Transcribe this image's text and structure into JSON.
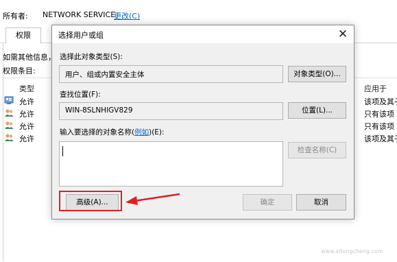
{
  "background": {
    "owner_label": "所有者:",
    "owner_value": "NETWORK SERVICE",
    "owner_change_link": "更改(C)",
    "tab_permissions": "权限",
    "info_text": "如需其他信息，",
    "entries_label": "权限条目:",
    "col_type": "类型",
    "col_applies_to": "应用于",
    "rows": [
      {
        "type": "允许",
        "applies_to": "该项及其子",
        "icon": "group-icon"
      },
      {
        "type": "允许",
        "applies_to": "只有该项",
        "icon": "users-icon"
      },
      {
        "type": "允许",
        "applies_to": "只有该项",
        "icon": "users-icon"
      },
      {
        "type": "允许",
        "applies_to": "该项及其子",
        "icon": "users-icon"
      }
    ]
  },
  "dialog": {
    "title": "选择用户或组",
    "object_type_label": "选择此对象类型(S):",
    "object_type_value": "用户、组或内置安全主体",
    "object_type_button": "对象类型(O)...",
    "location_label": "查找位置(F):",
    "location_value": "WIN-8SLNHIGV829",
    "location_button": "位置(L)...",
    "names_label_prefix": "输入要选择的对象名称(",
    "names_label_link": "例如",
    "names_label_suffix": ")(E):",
    "names_value": "",
    "check_names_button": "检查名称(C)",
    "advanced_button": "高级(A)...",
    "ok_button": "确定",
    "cancel_button": "取消"
  },
  "colors": {
    "annotation": "#e02020",
    "link": "#0066cc"
  }
}
